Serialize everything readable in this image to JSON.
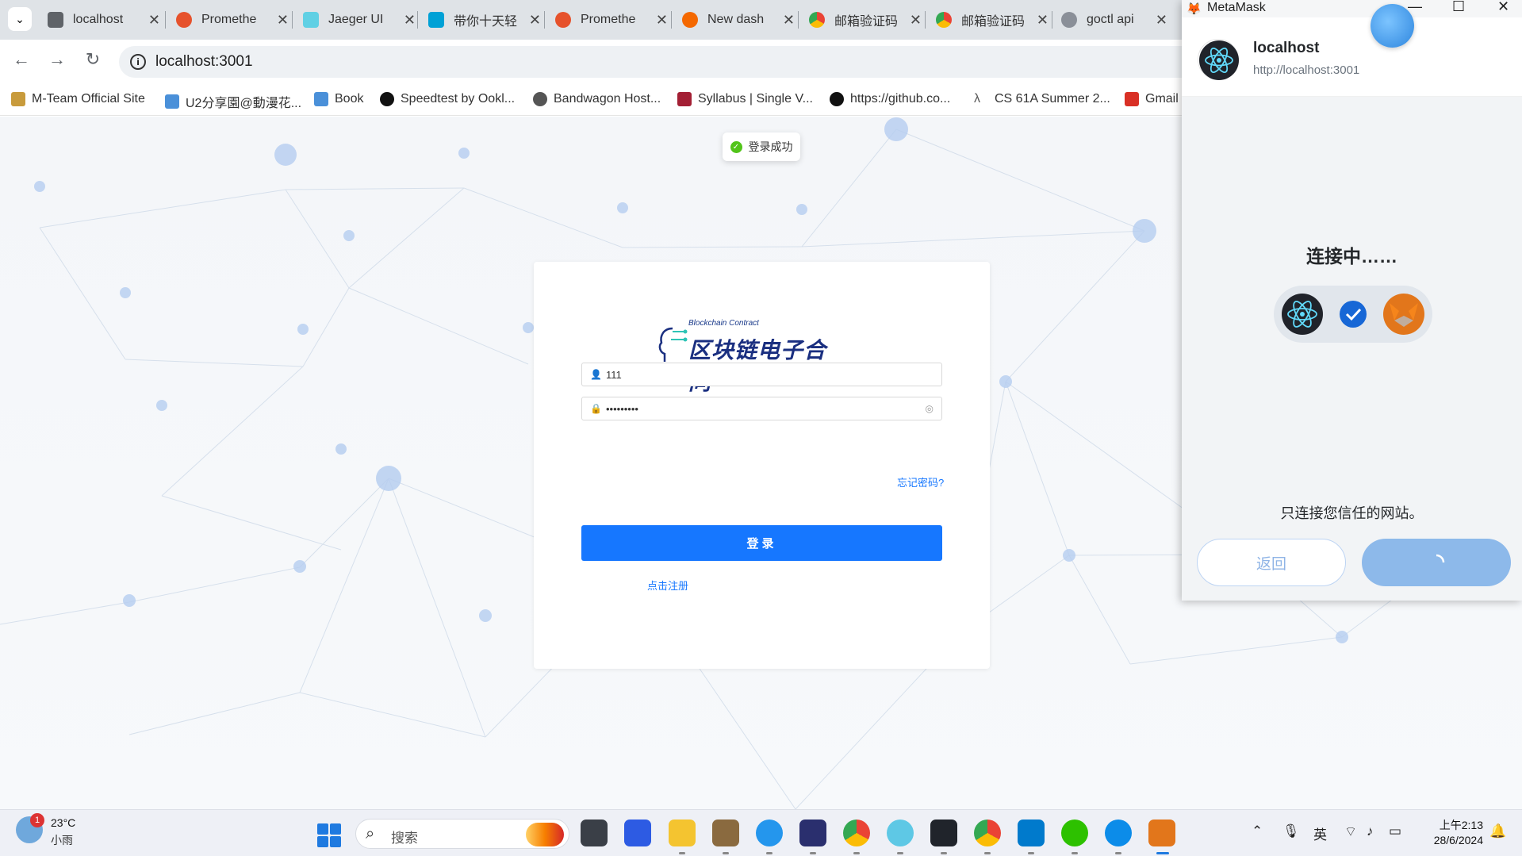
{
  "tabs": [
    {
      "title": "localhost",
      "color": "#5f6368"
    },
    {
      "title": "Promethe",
      "color": "#e6522c"
    },
    {
      "title": "Jaeger UI",
      "color": "#60d0e4"
    },
    {
      "title": "带你十天轻",
      "color": "#00a1d6"
    },
    {
      "title": "Promethe",
      "color": "#e6522c"
    },
    {
      "title": "New dash",
      "color": "#f46800"
    },
    {
      "title": "邮箱验证码",
      "color": "#34a853"
    },
    {
      "title": "邮箱验证码",
      "color": "#34a853"
    },
    {
      "title": "goctl api",
      "color": "#8a8f98"
    }
  ],
  "tab_close": "✕",
  "address": {
    "url": "localhost:3001",
    "info": "i"
  },
  "bookmarks": [
    {
      "label": "M-Team Official Site",
      "color": "#c89b3c"
    },
    {
      "label": "U2分享園@動漫花...",
      "color": "#4a90d9"
    },
    {
      "label": "Book",
      "color": "#4a90d9"
    },
    {
      "label": "Speedtest by Ookl...",
      "color": "#111111"
    },
    {
      "label": "Bandwagon Host...",
      "color": "#555555"
    },
    {
      "label": "Syllabus | Single V...",
      "color": "#a31f34"
    },
    {
      "label": "https://github.co...",
      "color": "#111111"
    },
    {
      "label": "CS 61A Summer 2...",
      "color": "#555555"
    },
    {
      "label": "Gmail",
      "color": "#d93025"
    }
  ],
  "toast": {
    "text": "登录成功",
    "check": "✓"
  },
  "login": {
    "logo_tag": "Blockchain Contract",
    "logo_text": "区块链电子合同",
    "username_value": "111",
    "password_value": "•••••••••",
    "forgot": "忘记密码?",
    "login_button": "登录",
    "register_link": "点击注册"
  },
  "metamask": {
    "window_title": "MetaMask",
    "site_name": "localhost",
    "site_url": "http://localhost:3001",
    "connecting": "连接中……",
    "trust_note": "只连接您信任的网站。",
    "back_button": "返回",
    "winctrl": {
      "minimize": "—",
      "maximize": "☐",
      "close": "✕"
    }
  },
  "taskbar": {
    "weather_temp": "23°C",
    "weather_desc": "小雨",
    "weather_badge": "1",
    "search_placeholder": "搜索",
    "ime": "英",
    "time": "上午2:13",
    "date": "28/6/2024"
  },
  "colors": {
    "accent": "#1677ff",
    "mm_accent": "#8db9ea"
  }
}
